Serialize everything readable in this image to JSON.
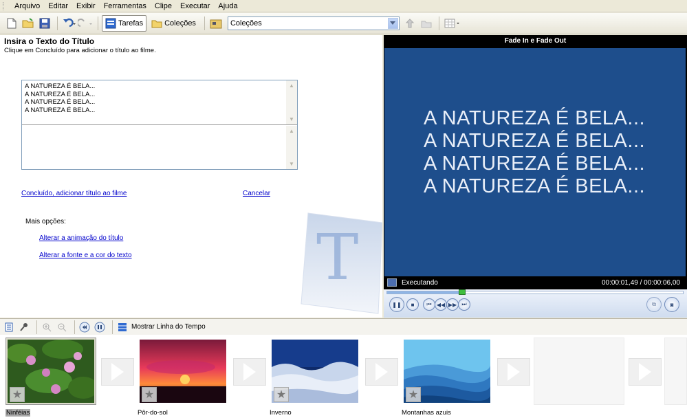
{
  "menu": [
    "Arquivo",
    "Editar",
    "Exibir",
    "Ferramentas",
    "Clipe",
    "Executar",
    "Ajuda"
  ],
  "toolbar": {
    "tasks_label": "Tarefas",
    "collections_label": "Coleções",
    "collections_select": "Coleções"
  },
  "task_pane": {
    "title": "Insira o Texto do Título",
    "subtitle": "Clique em Concluído para adicionar o título ao filme.",
    "title_lines": [
      "A NATUREZA É BELA...",
      "A NATUREZA É BELA...",
      "A NATUREZA É BELA...",
      "A NATUREZA É BELA..."
    ],
    "done_link": "Concluído, adicionar título ao filme",
    "cancel_link": "Cancelar",
    "more_options": "Mais opções:",
    "change_animation_link": "Alterar a animação do título",
    "change_font_link": "Alterar a fonte e a cor do texto"
  },
  "preview": {
    "title": "Fade In e Fade Out",
    "text_lines": [
      "A NATUREZA É BELA...",
      "A NATUREZA É BELA...",
      "A NATUREZA É BELA...",
      "A NATUREZA É BELA..."
    ],
    "status": "Executando",
    "time": "00:00:01,49 / 00:00:06,00",
    "progress": 0.25,
    "bg_color": "#1e4e8c"
  },
  "storyboard": {
    "show_timeline_label": "Mostrar Linha do Tempo",
    "clips": [
      {
        "label": "Ninféias",
        "selected": true
      },
      {
        "label": "Pôr-do-sol",
        "selected": false
      },
      {
        "label": "Inverno",
        "selected": false
      },
      {
        "label": "Montanhas azuis",
        "selected": false
      }
    ]
  }
}
